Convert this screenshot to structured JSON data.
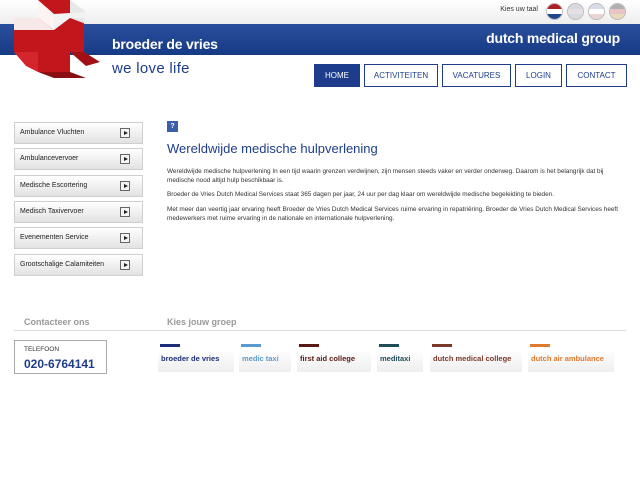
{
  "header": {
    "language_label": "Kies uw taal",
    "brand_name": "broeder de vries",
    "group_name": "dutch medical group",
    "tagline": "we love life"
  },
  "languages": [
    {
      "name": "nederlands-flag-icon",
      "colors": [
        "#ae1c28",
        "#ffffff",
        "#21468b"
      ]
    },
    {
      "name": "english-flag-icon",
      "colors": [
        "#d8d8e0",
        "#e4e0e6",
        "#d8d8e0"
      ]
    },
    {
      "name": "french-flag-icon",
      "colors": [
        "#d8dbe8",
        "#ffffff",
        "#ead4d4"
      ]
    },
    {
      "name": "german-flag-icon",
      "colors": [
        "#b0b0b0",
        "#e8c4c4",
        "#ead9b8"
      ]
    }
  ],
  "nav": [
    {
      "label": "HOME",
      "active": true
    },
    {
      "label": "ACTIVITEITEN",
      "active": false
    },
    {
      "label": "VACATURES",
      "active": false
    },
    {
      "label": "LOGIN",
      "active": false
    },
    {
      "label": "CONTACT",
      "active": false
    }
  ],
  "sidebar": [
    {
      "label": "Ambulance Vluchten"
    },
    {
      "label": "Ambulancevervoer"
    },
    {
      "label": "Medische Escortering"
    },
    {
      "label": "Medisch Taxivervoer"
    },
    {
      "label": "Evenementen Service"
    },
    {
      "label": "Grootschalige Calamiteiten"
    }
  ],
  "main": {
    "help_icon": "?",
    "title": "Wereldwijde medische hulpverlening",
    "paragraphs": [
      "Wereldwijde medische hulpverlening In een tijd waarin grenzen verdwijnen, zijn mensen steeds vaker en verder onderweg. Daarom is het belangrijk dat bij medische nood altijd hulp beschikbaar is.",
      "Broeder de Vries Dutch Medical Services staat 365 dagen per jaar, 24 uur per dag klaar om wereldwijde medische begeleiding te bieden.",
      "Met meer dan veertig jaar ervaring heeft Broeder de Vries Dutch Medical Services ruime ervaring in repatriëring. Broeder de Vries Dutch Medical Services heeft medewerkers met ruime ervaring in de nationale en internationale hulpverlening."
    ]
  },
  "footer": {
    "contact_heading": "Contacteer ons",
    "group_heading": "Kies jouw groep",
    "phone_label": "TELEFOON",
    "phone_number": "020-6764141",
    "groups": [
      {
        "label": "broeder de vries",
        "color": "#1d2d7a"
      },
      {
        "label": "medic taxi",
        "color": "#5a9ad0"
      },
      {
        "label": "first aid college",
        "color": "#5a1a14"
      },
      {
        "label": "meditaxi",
        "color": "#1e4d5a"
      },
      {
        "label": "dutch medical college",
        "color": "#7a3a2a"
      },
      {
        "label": "dutch air ambulance",
        "color": "#e07a30"
      }
    ]
  }
}
